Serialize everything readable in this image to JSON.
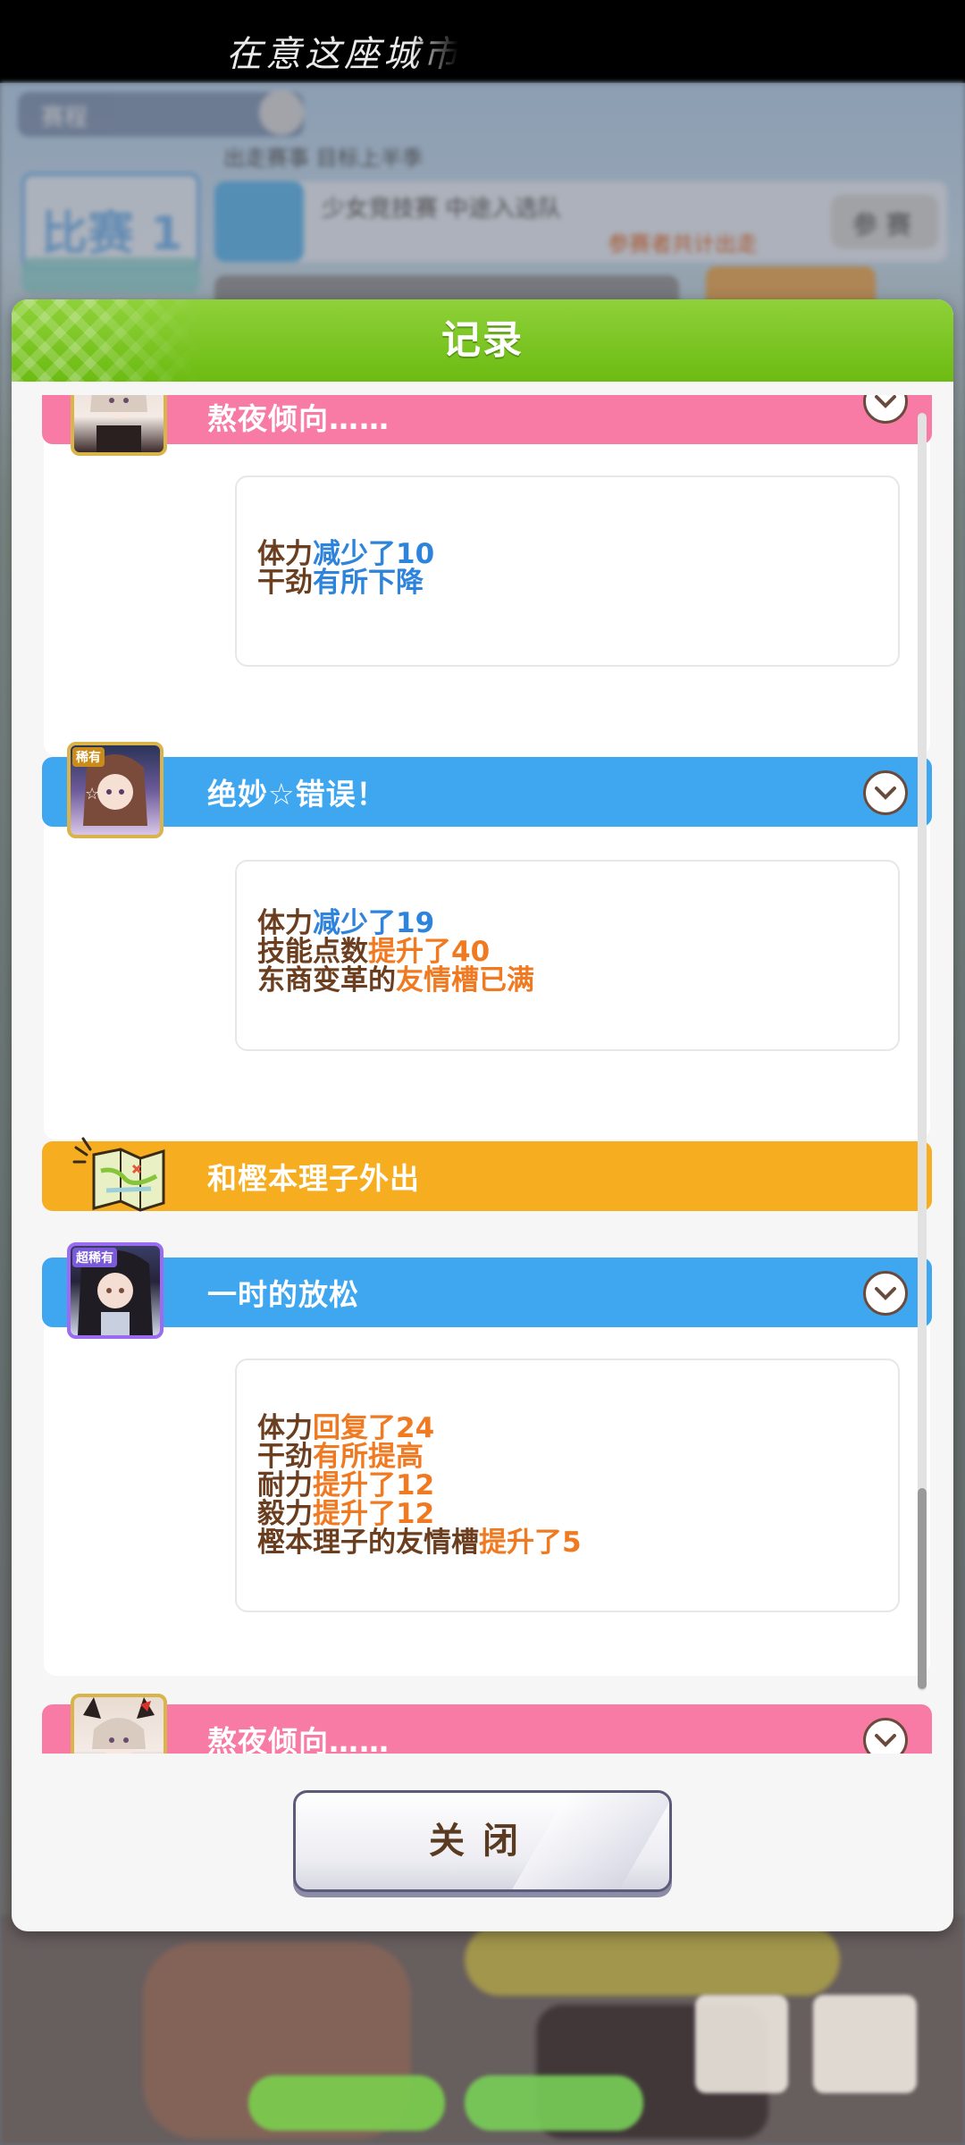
{
  "status_caption": "在意这座城市",
  "background": {
    "tab_text": "赛程",
    "race_label": "比赛 1",
    "race_info": "出走赛事 目标上半季",
    "race_detail": "少女竞技赛 中途入选队",
    "race_note": "参赛者共计出走",
    "enter_label": "参 赛"
  },
  "dialog": {
    "title": "记录",
    "close_label": "关闭",
    "entries": [
      {
        "type": "pink",
        "title": "熬夜倾向……",
        "lines": [
          {
            "prefix": "体力",
            "value": "减少了10",
            "tone": "blue"
          },
          {
            "prefix": "干劲",
            "value": "有所下降",
            "tone": "blue"
          }
        ]
      },
      {
        "type": "blue",
        "title": "绝妙☆错误！",
        "avatar_tag": "稀有",
        "lines": [
          {
            "prefix": "体力",
            "value": "减少了19",
            "tone": "blue"
          },
          {
            "prefix": "技能点数",
            "value": "提升了40",
            "tone": "orange"
          },
          {
            "prefix": "东商变革的",
            "value": "友情槽已满",
            "tone": "orange"
          }
        ]
      },
      {
        "type": "orange",
        "title": "和樫本理子外出"
      },
      {
        "type": "blue",
        "title": "一时的放松",
        "avatar_tag": "超稀有",
        "lines": [
          {
            "prefix": "体力",
            "value": "回复了24",
            "tone": "orange"
          },
          {
            "prefix": "干劲",
            "value": "有所提高",
            "tone": "orange"
          },
          {
            "prefix": "耐力",
            "value": "提升了12",
            "tone": "orange"
          },
          {
            "prefix": "毅力",
            "value": "提升了12",
            "tone": "orange"
          },
          {
            "prefix": "樫本理子的友情槽",
            "value": "提升了5",
            "tone": "orange"
          }
        ]
      },
      {
        "type": "pink",
        "title": "熬夜倾向……"
      }
    ]
  },
  "icons": {
    "expand": "chevron-down-icon",
    "outing": "map-icon"
  },
  "colors": {
    "header_green": "#7cc524",
    "bar_pink": "#f77ba4",
    "bar_blue": "#3fa7ef",
    "bar_orange": "#f6ae20",
    "text_brown": "#6b3e1f",
    "highlight_blue": "#2e83db",
    "highlight_orange": "#f07a21"
  }
}
